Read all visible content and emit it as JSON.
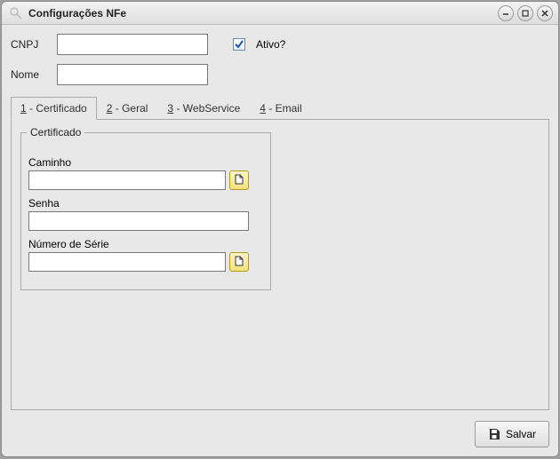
{
  "window": {
    "title": "Configurações NFe"
  },
  "form": {
    "cnpj_label": "CNPJ",
    "cnpj_value": "",
    "nome_label": "Nome",
    "nome_value": "",
    "ativo_label": "Ativo?",
    "ativo_checked": true
  },
  "tabs": [
    {
      "accesskey": "1",
      "label": "Certificado"
    },
    {
      "accesskey": "2",
      "label": "Geral"
    },
    {
      "accesskey": "3",
      "label": "WebService"
    },
    {
      "accesskey": "4",
      "label": "Email"
    }
  ],
  "certificado": {
    "legend": "Certificado",
    "caminho_label": "Caminho",
    "caminho_value": "",
    "senha_label": "Senha",
    "senha_value": "",
    "numero_label": "Número de Série",
    "numero_value": ""
  },
  "actions": {
    "salvar_label": "Salvar"
  }
}
